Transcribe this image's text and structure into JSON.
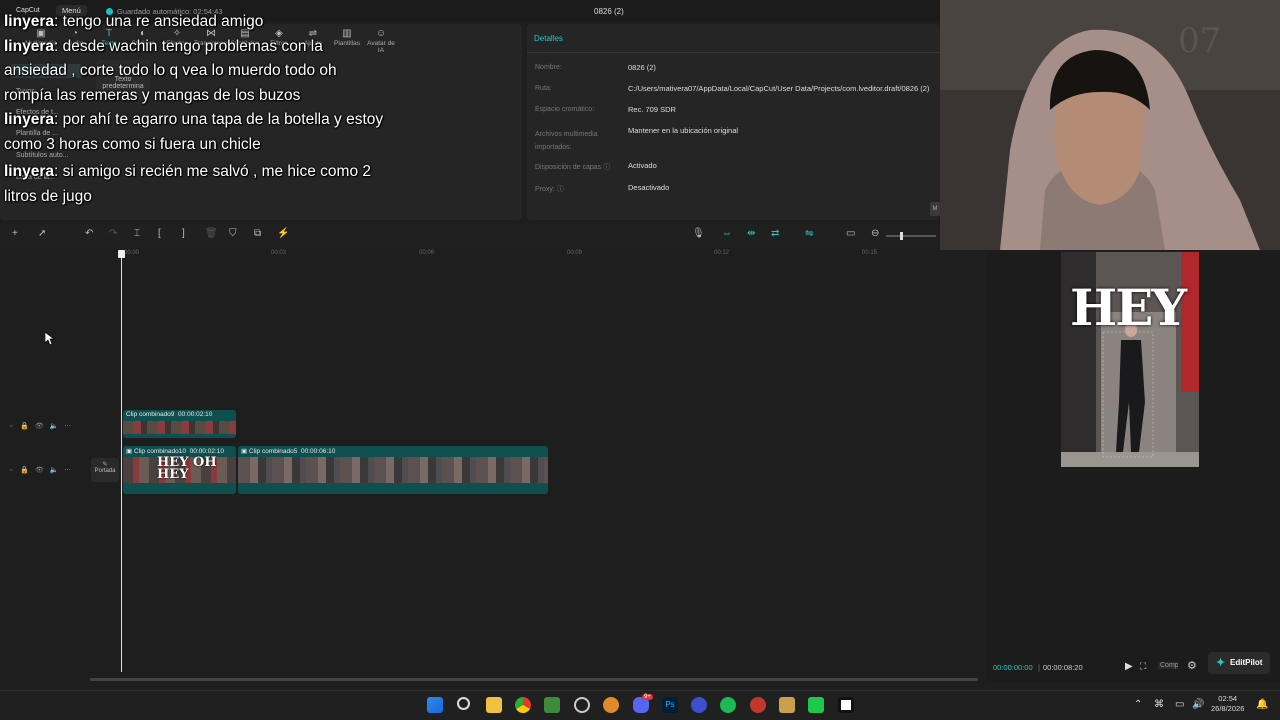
{
  "app": {
    "brand": "CapCut",
    "menu_label": "Menú",
    "saved_status": "Guardado automático: 02:54:43",
    "project_title": "0826 (2)"
  },
  "toolbar_tabs": [
    {
      "label": "Multimedia",
      "icon": "media-icon"
    },
    {
      "label": "Audio",
      "icon": "audio-icon"
    },
    {
      "label": "Texto",
      "icon": "text-icon"
    },
    {
      "label": "Stickers",
      "icon": "sticker-icon"
    },
    {
      "label": "Efectos",
      "icon": "effects-icon"
    },
    {
      "label": "Transiciones",
      "icon": "transition-icon"
    },
    {
      "label": "Subtítulos",
      "icon": "subtitle-icon"
    },
    {
      "label": "Filtros",
      "icon": "filter-icon"
    },
    {
      "label": "Ajuste",
      "icon": "adjust-icon"
    },
    {
      "label": "Plantillas",
      "icon": "template-icon"
    },
    {
      "label": "Avatar de IA",
      "icon": "avatar-icon"
    }
  ],
  "side_menu": [
    {
      "label": "Agregar texto"
    },
    {
      "label": "Tuyos"
    },
    {
      "label": "Efectos de t..."
    },
    {
      "label": "Plantilla de ..."
    },
    {
      "label": "Subtítulos auto..."
    },
    {
      "label": "Letra de la..."
    }
  ],
  "text_preset": {
    "label": "Texto predetermina"
  },
  "chat": [
    {
      "user": "linyera",
      "text": ": tengo una re ansiedad amigo"
    },
    {
      "user": "linyera",
      "text": ": desde wachin tengo problemas con la ansiedad , corte todo lo q vea lo muerdo todo oh rompía las remeras y mangas de los buzos"
    },
    {
      "user": "linyera",
      "text": ": por ahí te agarro una tapa de la botella y estoy como 3 horas como si fuera un chicle"
    },
    {
      "user": "linyera",
      "text": ": si amigo si recién me salvó , me hice como 2 litros de jugo"
    }
  ],
  "details": {
    "header": "Detalles",
    "rows": [
      {
        "key": "Nombre:",
        "value": "0826 (2)"
      },
      {
        "key": "Ruta:",
        "value": "C:/Users/mativera07/AppData/Local/CapCut/User Data/Projects/com.lveditor.draft/0826 (2)"
      },
      {
        "key": "Espacio cromático:",
        "value": "Rec. 709 SDR"
      },
      {
        "key": "Archivos multimedia importados:",
        "value": "Mantener en la ubicación original"
      },
      {
        "key": "Disposición de capas ⓘ",
        "value": "Activado"
      },
      {
        "key": "Proxy: ⓘ",
        "value": "Desactivado"
      }
    ],
    "toggle": "M"
  },
  "ruler_ticks": [
    "00:00",
    "00:03",
    "00:06",
    "00:09",
    "00:12",
    "00:15"
  ],
  "clips": [
    {
      "name": "Clip combinado9",
      "duration": "00:00:02:10"
    },
    {
      "name": "Clip combinado10",
      "duration": "00:00:02:10"
    },
    {
      "name": "Clip combinado5",
      "duration": "00:00:06:10"
    }
  ],
  "clip_overlay_text": "HEY OH HEY",
  "portada_label": "Portada",
  "preview": {
    "overlay_text": "HEY",
    "current_time": "00:00:00:00",
    "total_time": "00:00:08:20",
    "ratio_label": "Comp.",
    "editpilot_label": "EditPilot"
  },
  "taskbar": {
    "time": "02:54",
    "date": "26/8/2026",
    "badge_count": "9+"
  }
}
